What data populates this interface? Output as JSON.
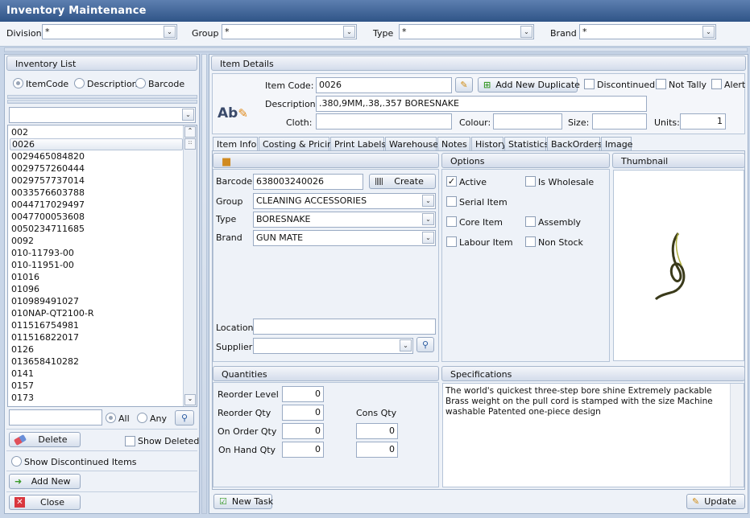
{
  "window": {
    "title": "Inventory Maintenance"
  },
  "filters": {
    "division_label": "Division",
    "division_value": "*",
    "group_label": "Group",
    "group_value": "*",
    "type_label": "Type",
    "type_value": "*",
    "brand_label": "Brand",
    "brand_value": "*"
  },
  "inventory_list": {
    "title": "Inventory List",
    "search_by": [
      {
        "label": "ItemCode",
        "selected": true
      },
      {
        "label": "Description",
        "selected": false
      },
      {
        "label": "Barcode",
        "selected": false
      }
    ],
    "filter_value": "",
    "selected_item": "0026",
    "items": [
      "002",
      "0026",
      "0029465084820",
      "0029757260444",
      "0029757737014",
      "0033576603788",
      "0044717029497",
      "0047700053608",
      "0050234711685",
      "0092",
      "010-11793-00",
      "010-11951-00",
      "01016",
      "01096",
      "010989491027",
      "010NAP-QT2100-R",
      "011516754981",
      "011516822017",
      "0126",
      "013658410282",
      "0141",
      "0157",
      "0173"
    ],
    "search_value": "",
    "match_all_label": "All",
    "match_any_label": "Any",
    "match": "All",
    "delete_label": "Delete",
    "show_deleted_label": "Show Deleted",
    "show_deleted": false,
    "show_discontinued_label": "Show Discontinued Items",
    "add_new_label": "Add New",
    "close_label": "Close"
  },
  "item_details": {
    "title": "Item Details",
    "item_code_label": "Item Code:",
    "item_code": "0026",
    "add_duplicate_label": "Add New Duplicate",
    "discontinued_label": "Discontinued",
    "not_tally_label": "Not Tally",
    "alert_label": "Alert",
    "description_label": "Description:",
    "description": ".380,9MM,.38,.357 BORESNAKE",
    "cloth_label": "Cloth:",
    "cloth": "",
    "colour_label": "Colour:",
    "colour": "",
    "size_label": "Size:",
    "size": "",
    "units_label": "Units:",
    "units": "1"
  },
  "tabs": [
    "Item Info",
    "Costing & Pricing",
    "Print Labels",
    "Warehouse",
    "Notes",
    "History",
    "Statistics",
    "BackOrders",
    "Image"
  ],
  "active_tab": "Item Info",
  "item_info": {
    "barcode_label": "Barcode",
    "barcode": "638003240026",
    "create_label": "Create",
    "group_label": "Group",
    "group": "CLEANING ACCESSORIES",
    "type_label": "Type",
    "type": "BORESNAKE",
    "brand_label": "Brand",
    "brand": "GUN MATE",
    "location_label": "Location",
    "location": "",
    "supplier_label": "Supplier",
    "supplier": ""
  },
  "options": {
    "title": "Options",
    "active_label": "Active",
    "active": true,
    "wholesale_label": "Is Wholesale",
    "serial_label": "Serial Item",
    "assembly_label": "Assembly",
    "core_label": "Core Item",
    "non_stock_label": "Non Stock",
    "labour_label": "Labour Item"
  },
  "thumbnail": {
    "title": "Thumbnail"
  },
  "quantities": {
    "title": "Quantities",
    "reorder_level_label": "Reorder Level",
    "reorder_level": "0",
    "reorder_qty_label": "Reorder Qty",
    "reorder_qty": "0",
    "cons_qty_label": "Cons Qty",
    "on_order_label": "On Order Qty",
    "on_order": "0",
    "on_order_cons": "0",
    "on_hand_label": "On Hand Qty",
    "on_hand": "0",
    "on_hand_cons": "0"
  },
  "specifications": {
    "title": "Specifications",
    "text": "The world's quickest three-step bore shine Extremely packable Brass weight on the pull cord is stamped with the size Machine washable Patented one-piece design"
  },
  "footer": {
    "new_task_label": "New Task",
    "update_label": "Update"
  }
}
